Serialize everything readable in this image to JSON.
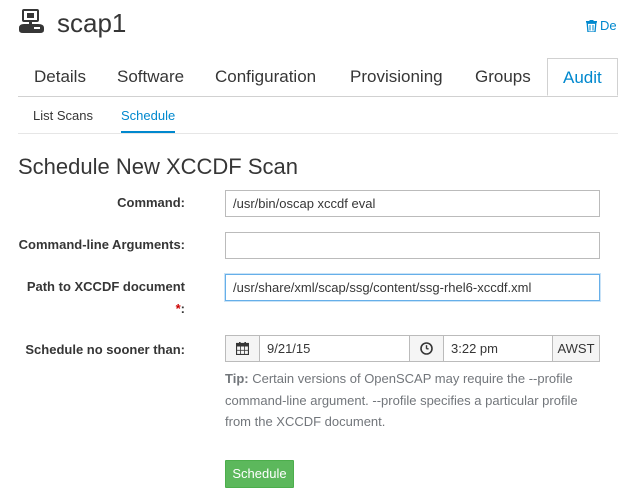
{
  "header": {
    "system_name": "scap1",
    "delete_label": "De"
  },
  "tabs": [
    {
      "label": "Details"
    },
    {
      "label": "Software"
    },
    {
      "label": "Configuration"
    },
    {
      "label": "Provisioning"
    },
    {
      "label": "Groups"
    },
    {
      "label": "Audit",
      "active": true
    }
  ],
  "subtabs": [
    {
      "label": "List Scans"
    },
    {
      "label": "Schedule",
      "active": true
    }
  ],
  "form": {
    "heading": "Schedule New XCCDF Scan",
    "command": {
      "label": "Command:",
      "value": "/usr/bin/oscap xccdf eval"
    },
    "args": {
      "label": "Command-line Arguments:",
      "value": ""
    },
    "path": {
      "label": "Path to XCCDF document",
      "required": "*",
      "colon": ":",
      "value": "/usr/share/xml/scap/ssg/content/ssg-rhel6-xccdf.xml"
    },
    "schedule": {
      "label": "Schedule no sooner than:",
      "date": "9/21/15",
      "time": "3:22 pm",
      "timezone": "AWST"
    },
    "tip": {
      "prefix": "Tip:",
      "text": " Certain versions of OpenSCAP may require the --profile command-line argument. --profile specifies a particular profile from the XCCDF document."
    },
    "submit_label": "Schedule"
  },
  "colors": {
    "accent": "#0088ce",
    "button": "#5cb85c",
    "required": "#cc0000"
  },
  "icons": [
    "system-icon",
    "trash-icon",
    "calendar-icon",
    "clock-icon"
  ]
}
